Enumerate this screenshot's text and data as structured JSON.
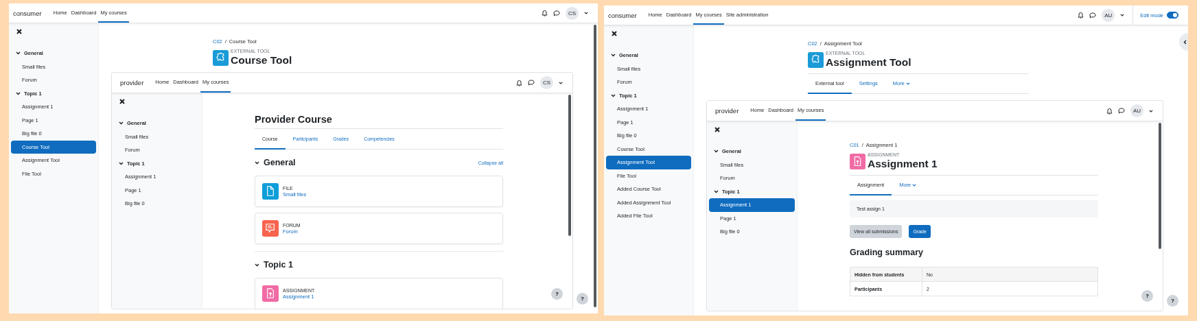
{
  "screens": [
    {
      "navbar": {
        "brand": "consumer",
        "links": [
          {
            "label": "Home",
            "selected": false
          },
          {
            "label": "Dashboard",
            "selected": false
          },
          {
            "label": "My courses",
            "selected": true
          }
        ],
        "avatar": "CS"
      },
      "sidebar": {
        "sections": [
          {
            "label": "General",
            "expanded": true,
            "children": [
              {
                "label": "Small files",
                "selected": false
              },
              {
                "label": "Forum",
                "selected": false
              }
            ]
          },
          {
            "label": "Topic 1",
            "expanded": true,
            "children": [
              {
                "label": "Assignment 1",
                "selected": false
              },
              {
                "label": "Page 1",
                "selected": false
              },
              {
                "label": "Big file 0",
                "selected": false
              },
              {
                "label": "Course Tool",
                "selected": true
              },
              {
                "label": "Assignment Tool",
                "selected": false
              },
              {
                "label": "File Tool",
                "selected": false
              }
            ]
          }
        ]
      },
      "page": {
        "breadcrumb": {
          "separator": "/",
          "items": [
            {
              "label": "C02",
              "link": true
            },
            {
              "label": "Course Tool",
              "link": false
            }
          ]
        },
        "kind": "tool",
        "overline": "EXTERNAL TOOL",
        "title": "Course Tool",
        "embedded": {
          "navbar": {
            "brand": "provider",
            "links": [
              {
                "label": "Home",
                "selected": false
              },
              {
                "label": "Dashboard",
                "selected": false
              },
              {
                "label": "My courses",
                "selected": true
              }
            ],
            "avatar": "CS"
          },
          "sidebar": {
            "sections": [
              {
                "label": "General",
                "expanded": true,
                "children": [
                  {
                    "label": "Small files",
                    "selected": false
                  },
                  {
                    "label": "Forum",
                    "selected": false
                  }
                ]
              },
              {
                "label": "Topic 1",
                "expanded": true,
                "children": [
                  {
                    "label": "Assignment 1",
                    "selected": false
                  },
                  {
                    "label": "Page 1",
                    "selected": false
                  },
                  {
                    "label": "Big file 0",
                    "selected": false
                  }
                ]
              }
            ]
          },
          "page": {
            "course_title": "Provider Course",
            "tabs": [
              {
                "label": "Course",
                "selected": true
              },
              {
                "label": "Participants",
                "selected": false
              },
              {
                "label": "Grades",
                "selected": false
              },
              {
                "label": "Competencies",
                "selected": false
              }
            ],
            "sections": [
              {
                "title": "General",
                "expanded": true,
                "action": "Collapse all",
                "activities": [
                  {
                    "kind": "file",
                    "type_label": "FILE",
                    "name": "Small files"
                  },
                  {
                    "kind": "forum",
                    "type_label": "FORUM",
                    "name": "Forum"
                  }
                ]
              },
              {
                "title": "Topic 1",
                "expanded": true,
                "activities": [
                  {
                    "kind": "assign",
                    "type_label": "ASSIGNMENT",
                    "name": "Assignment 1"
                  }
                ]
              }
            ]
          },
          "help": "?"
        }
      },
      "help": "?"
    },
    {
      "navbar": {
        "brand": "consumer",
        "links": [
          {
            "label": "Home",
            "selected": false
          },
          {
            "label": "Dashboard",
            "selected": false
          },
          {
            "label": "My courses",
            "selected": true
          },
          {
            "label": "Site administration",
            "selected": false
          }
        ],
        "avatar": "AU",
        "edit_mode": {
          "label": "Edit mode",
          "on": true
        }
      },
      "sidebar": {
        "sections": [
          {
            "label": "General",
            "expanded": true,
            "children": [
              {
                "label": "Small files",
                "selected": false
              },
              {
                "label": "Forum",
                "selected": false
              }
            ]
          },
          {
            "label": "Topic 1",
            "expanded": true,
            "children": [
              {
                "label": "Assignment 1",
                "selected": false
              },
              {
                "label": "Page 1",
                "selected": false
              },
              {
                "label": "Big file 0",
                "selected": false
              },
              {
                "label": "Course Tool",
                "selected": false
              },
              {
                "label": "Assignment Tool",
                "selected": true
              },
              {
                "label": "File Tool",
                "selected": false
              },
              {
                "label": "Added Course Tool",
                "selected": false
              },
              {
                "label": "Added Assignment Tool",
                "selected": false
              },
              {
                "label": "Added File Tool",
                "selected": false
              }
            ]
          }
        ]
      },
      "page": {
        "breadcrumb": {
          "separator": "/",
          "items": [
            {
              "label": "C02",
              "link": true
            },
            {
              "label": "Assignment Tool",
              "link": false
            }
          ]
        },
        "kind": "tool",
        "overline": "EXTERNAL TOOL",
        "title": "Assignment Tool",
        "tabs": [
          {
            "label": "External tool",
            "selected": true
          },
          {
            "label": "Settings",
            "selected": false
          },
          {
            "label": "More",
            "selected": false,
            "caret": true
          }
        ],
        "embedded": {
          "navbar": {
            "brand": "provider",
            "links": [
              {
                "label": "Home",
                "selected": false
              },
              {
                "label": "Dashboard",
                "selected": false
              },
              {
                "label": "My courses",
                "selected": true
              }
            ],
            "avatar": "AU"
          },
          "sidebar": {
            "sections": [
              {
                "label": "General",
                "expanded": true,
                "children": [
                  {
                    "label": "Small files",
                    "selected": false
                  },
                  {
                    "label": "Forum",
                    "selected": false
                  }
                ]
              },
              {
                "label": "Topic 1",
                "expanded": true,
                "children": [
                  {
                    "label": "Assignment 1",
                    "selected": true
                  },
                  {
                    "label": "Page 1",
                    "selected": false
                  },
                  {
                    "label": "Big file 0",
                    "selected": false
                  }
                ]
              }
            ]
          },
          "page": {
            "breadcrumb": {
              "separator": "/",
              "items": [
                {
                  "label": "C01",
                  "link": true
                },
                {
                  "label": "Assignment 1",
                  "link": false
                }
              ]
            },
            "kind": "assign",
            "overline": "ASSIGNMENT",
            "title": "Assignment 1",
            "tabs": [
              {
                "label": "Assignment",
                "selected": true
              },
              {
                "label": "More",
                "selected": false,
                "caret": true
              }
            ],
            "intro": "Test assign 1",
            "buttons": [
              {
                "label": "View all submissions",
                "kind": "secondary"
              },
              {
                "label": "Grade",
                "kind": "primary"
              }
            ],
            "summary": {
              "title": "Grading summary",
              "rows": [
                {
                  "label": "Hidden from students",
                  "value": "No"
                },
                {
                  "label": "Participants",
                  "value": "2"
                }
              ]
            }
          },
          "help": "?"
        }
      },
      "help": "?"
    }
  ]
}
